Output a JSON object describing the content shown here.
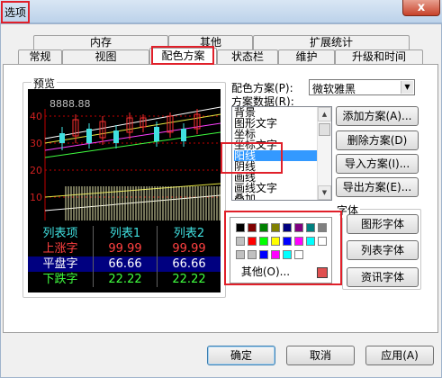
{
  "window": {
    "title": "选项",
    "close_glyph": "x"
  },
  "tabs_row1": [
    "内存",
    "其他",
    "扩展统计"
  ],
  "tabs_row2": [
    "常规",
    "视图",
    "配色方案",
    "状态栏",
    "维护",
    "升级和时间"
  ],
  "active_tab": "配色方案",
  "preview": {
    "label": "预览",
    "price_label": "8888.88",
    "y_ticks": [
      "40",
      "30",
      "20",
      "10"
    ],
    "table": {
      "headers": [
        "列表项",
        "列表1",
        "列表2"
      ],
      "rows": [
        {
          "label": "上涨字",
          "v1": "99.99",
          "v2": "99.99"
        },
        {
          "label": "平盘字",
          "v1": "66.66",
          "v2": "66.66"
        },
        {
          "label": "下跌字",
          "v1": "22.22",
          "v2": "22.22"
        }
      ]
    }
  },
  "scheme": {
    "label": "配色方案(P):",
    "selected": "微软雅黑"
  },
  "scheme_data": {
    "label": "方案数据(R):",
    "items": [
      "背景",
      "图形文字",
      "坐标",
      "坐标文字",
      "阳线",
      "阴线",
      "画线",
      "画线文字",
      "叠加"
    ],
    "selected_index": 4
  },
  "buttons": {
    "add": "添加方案(A)...",
    "delete": "删除方案(D)",
    "import": "导入方案(I)...",
    "export": "导出方案(E)...",
    "graph_font": "图形字体",
    "list_font": "列表字体",
    "news_font": "资讯字体",
    "ok": "确定",
    "cancel": "取消",
    "apply": "应用(A)"
  },
  "font_group": {
    "label": "字体"
  },
  "palette": {
    "row1": [
      "#000000",
      "#800000",
      "#008000",
      "#808000",
      "#000080",
      "#800080",
      "#008080",
      "#808080"
    ],
    "row2": [
      "#c0c0c0",
      "#ff0000",
      "#00ff00",
      "#ffff00",
      "#0000ff",
      "#ff00ff",
      "#00ffff",
      "#ffffff"
    ],
    "row3": [
      "#c0c0c0",
      "#c0c0c0",
      "#0000ff",
      "#ff00ff",
      "#00ffff",
      "#ffffff"
    ],
    "other_label": "其他(O)...",
    "custom_color": "#e05050"
  }
}
